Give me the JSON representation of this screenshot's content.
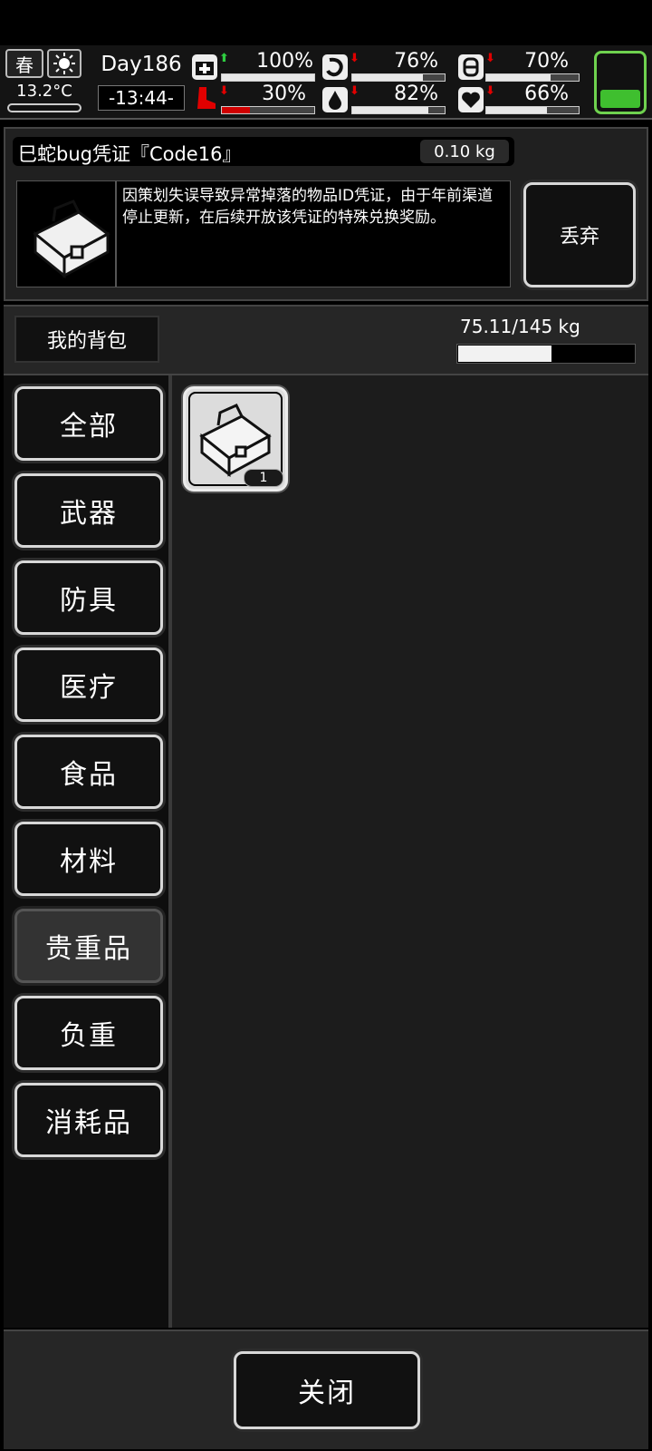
{
  "hud": {
    "season": "春",
    "temperature": "13.2°C",
    "day": "Day186",
    "time": "-13:44-",
    "stats": [
      {
        "icon": "medkit-icon",
        "value": "100%",
        "level": 1.0,
        "trend": "up",
        "trend_color": "#2ecc40"
      },
      {
        "icon": "stomach-icon",
        "value": "76%",
        "level": 0.76,
        "trend": "down",
        "trend_color": "#e00000"
      },
      {
        "icon": "energy-icon",
        "value": "70%",
        "level": 0.7,
        "trend": "down",
        "trend_color": "#e00000"
      },
      {
        "icon": "boot-icon",
        "value": "30%",
        "level": 0.3,
        "trend": "down",
        "trend_color": "#e00000",
        "bar_color": "#d00000"
      },
      {
        "icon": "water-drop-icon",
        "value": "82%",
        "level": 0.82,
        "trend": "down",
        "trend_color": "#e00000"
      },
      {
        "icon": "heart-icon",
        "value": "66%",
        "level": 0.66,
        "trend": "down",
        "trend_color": "#e00000"
      }
    ],
    "battery_color": "#3fbf2f"
  },
  "item": {
    "name": "巳蛇bug凭证『Code16』",
    "weight": "0.10 kg",
    "description": "因策划失误导致异常掉落的物品ID凭证，由于年前渠道停止更新，在后续开放该凭证的特殊兑换奖励。",
    "discard_label": "丢弃"
  },
  "bag": {
    "label": "我的背包",
    "capacity_text": "75.11/145 kg",
    "capacity_fraction": 0.518
  },
  "categories": [
    {
      "label": "全部",
      "active": false
    },
    {
      "label": "武器",
      "active": false
    },
    {
      "label": "防具",
      "active": false
    },
    {
      "label": "医疗",
      "active": false
    },
    {
      "label": "食品",
      "active": false
    },
    {
      "label": "材料",
      "active": false
    },
    {
      "label": "贵重品",
      "active": true
    },
    {
      "label": "负重",
      "active": false
    },
    {
      "label": "消耗品",
      "active": false
    }
  ],
  "inventory": [
    {
      "icon": "toolbox-icon",
      "count": "1"
    }
  ],
  "footer": {
    "close_label": "关闭"
  }
}
